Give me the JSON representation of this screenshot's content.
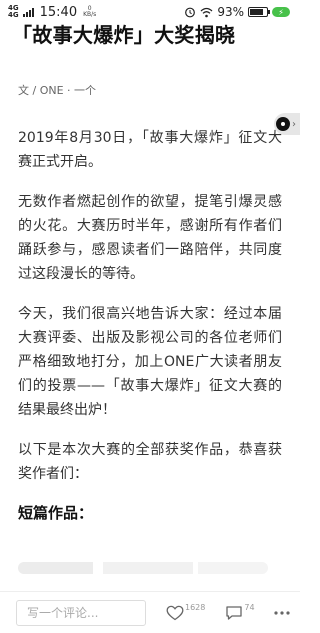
{
  "status_bar": {
    "network_top": "4G",
    "network_bottom": "4G",
    "speed": "0",
    "speed_unit": "KB/s",
    "time": "15:40",
    "battery": "93%",
    "battery_level": 0.93
  },
  "article": {
    "title": "「故事大爆炸」大奖揭晓",
    "byline": "文 / ONE · 一个",
    "paragraphs": [
      "2019年8月30日，「故事大爆炸」征文大赛正式开启。",
      "无数作者燃起创作的欲望，提笔引爆灵感的火花。大赛历时半年，感谢所有作者们踊跃参与，感恩读者们一路陪伴，共同度过这段漫长的等待。",
      "今天，我们很高兴地告诉大家：经过本届大赛评委、出版及影视公司的各位老师们严格细致地打分，加上ONE广大读者朋友们的投票——「故事大爆炸」征文大赛的结果最终出炉！",
      "以下是本次大赛的全部获奖作品，恭喜获奖作者们："
    ],
    "section_heading": "短篇作品："
  },
  "bottom_bar": {
    "comment_placeholder": "写一个评论...",
    "like_count": "1628",
    "comment_count": "74"
  },
  "icons": {
    "side_tab": "record-dot-icon",
    "like": "heart-icon",
    "comment": "comment-icon",
    "more": "more-dots-icon"
  }
}
